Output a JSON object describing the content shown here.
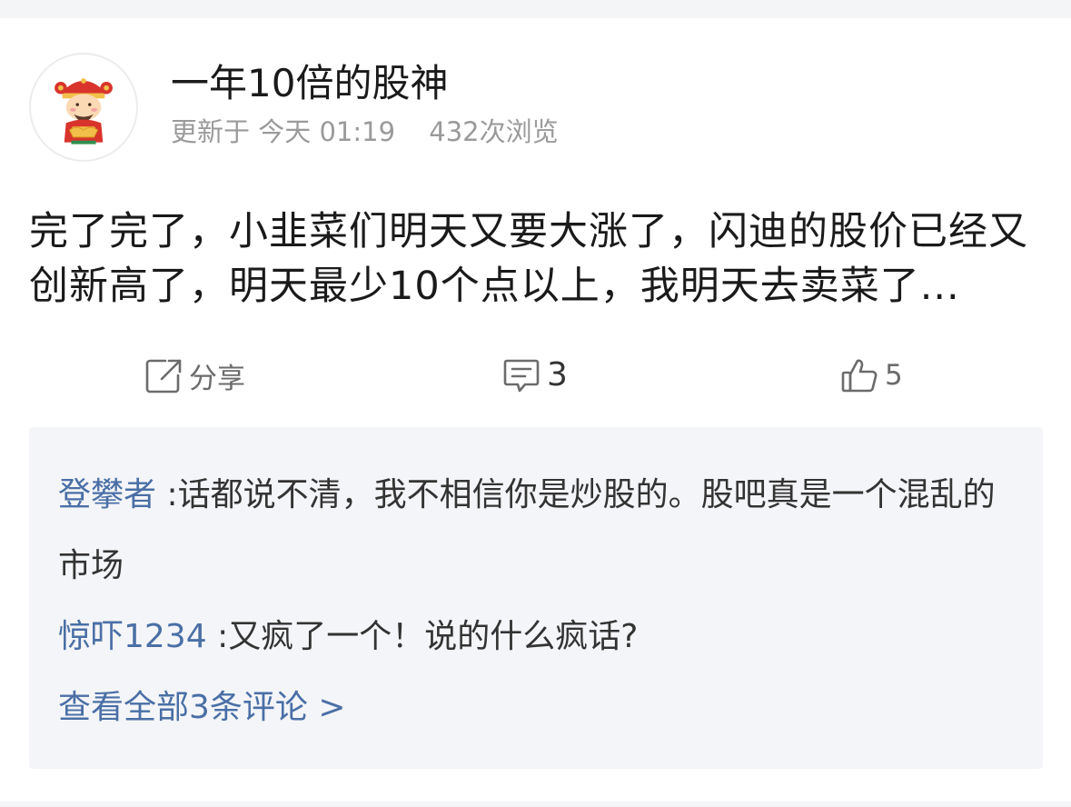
{
  "post": {
    "author": "一年10倍的股神",
    "updated_label": "更新于",
    "updated_time": "今天 01:19",
    "views": "432次浏览",
    "avatar_icon": "god-of-wealth-avatar",
    "text": "完了完了，小韭菜们明天又要大涨了，闪迪的股价已经又创新高了，明天最少10个点以上，我明天去卖菜了..."
  },
  "actions": {
    "share_label": "分享",
    "comment_count": "3",
    "like_count": "5",
    "icons": {
      "share": "share-icon",
      "comment": "comment-icon",
      "like": "thumbs-up-icon"
    }
  },
  "comments": [
    {
      "author": "登攀者",
      "text": " :话都说不清，我不相信你是炒股的。股吧真是一个混乱的市场"
    },
    {
      "author": "惊吓1234",
      "text": " :又疯了一个！说的什么疯话?"
    }
  ],
  "view_all": "查看全部3条评论 >",
  "colors": {
    "link": "#4a6fa5",
    "text": "#1a1a1a",
    "muted": "#9a9a9a",
    "comment_bg": "#f4f5f8",
    "page_bg": "#f4f5f7"
  }
}
